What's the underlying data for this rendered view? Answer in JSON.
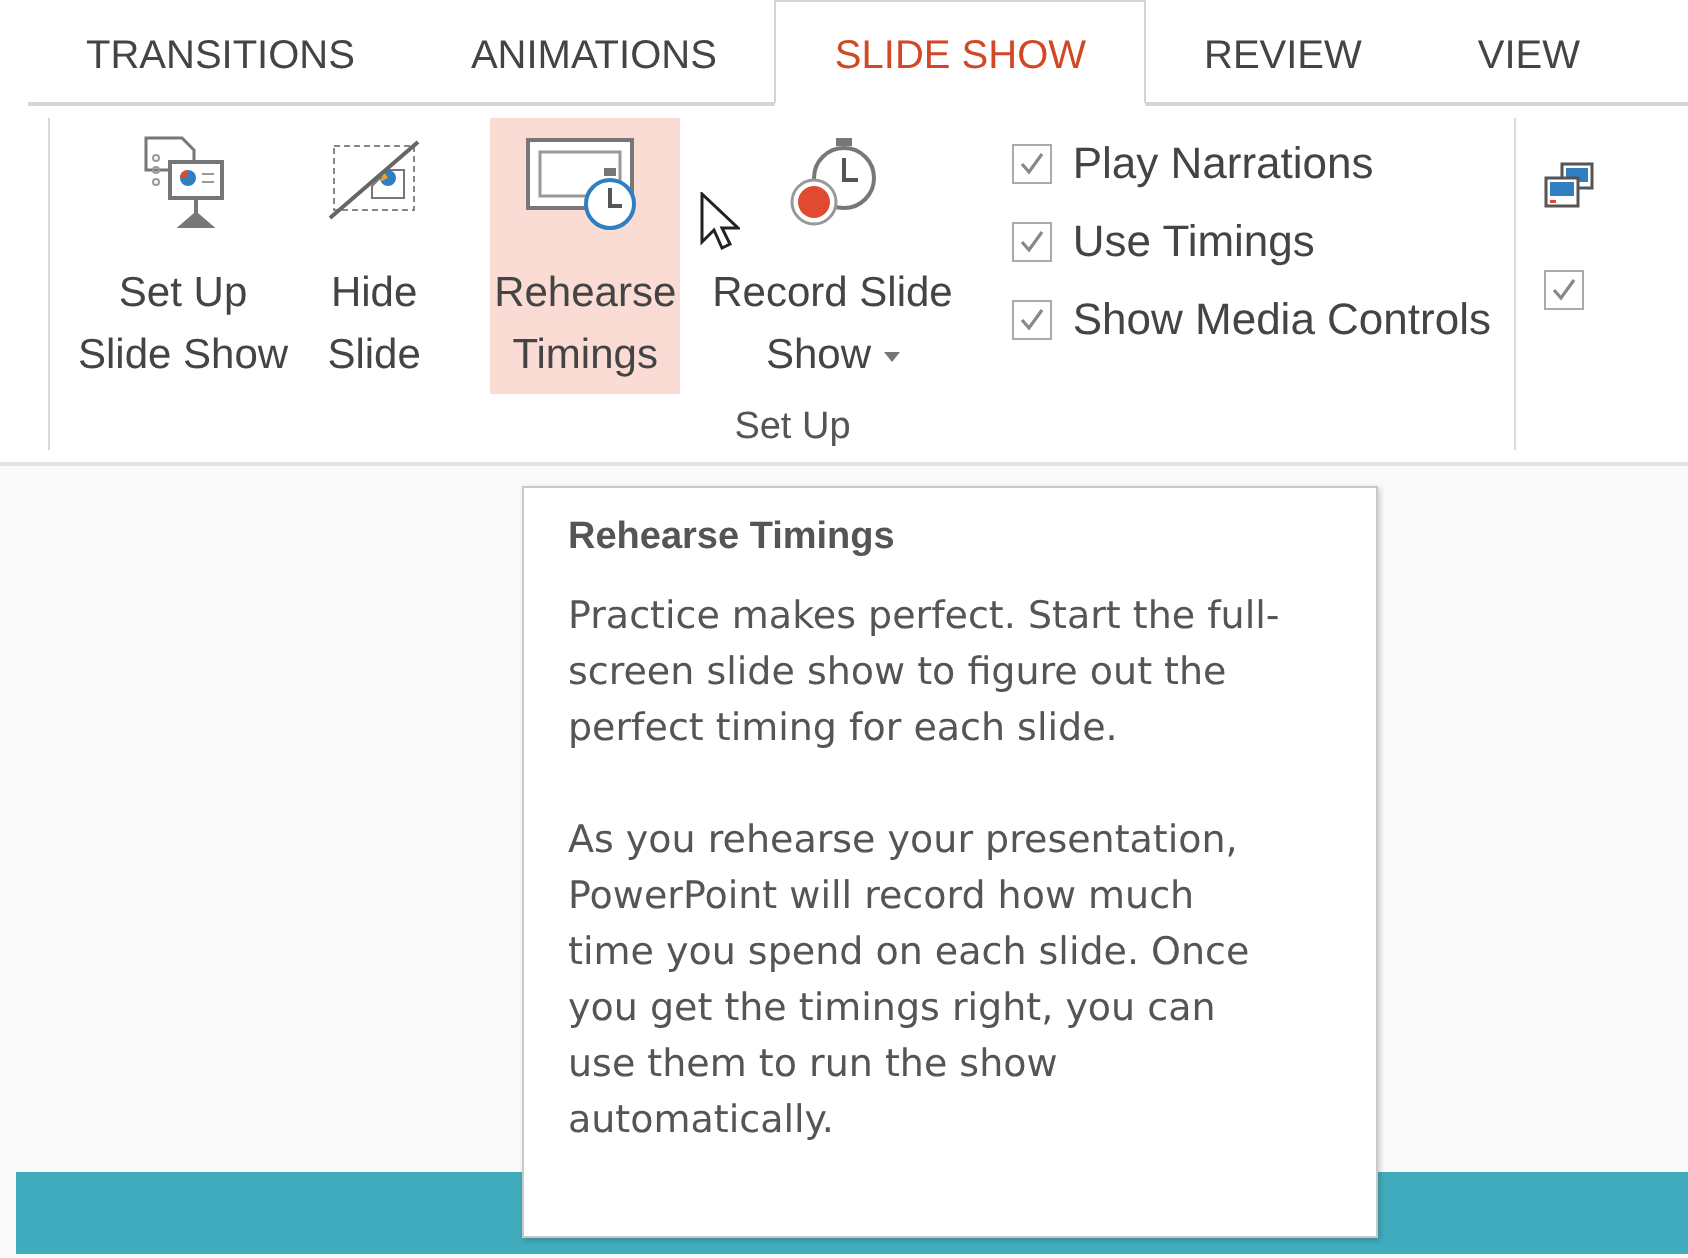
{
  "tabs": [
    {
      "label": "TRANSITIONS",
      "selected": false
    },
    {
      "label": "ANIMATIONS",
      "selected": false
    },
    {
      "label": "SLIDE SHOW",
      "selected": true
    },
    {
      "label": "REVIEW",
      "selected": false
    },
    {
      "label": "VIEW",
      "selected": false
    }
  ],
  "ribbon": {
    "buttons": [
      {
        "kind": "setup",
        "label_lines": [
          "Set Up",
          "Slide Show"
        ],
        "hovered": false,
        "dropdown": false
      },
      {
        "kind": "hide",
        "label_lines": [
          "Hide",
          "Slide"
        ],
        "hovered": false,
        "dropdown": false
      },
      {
        "kind": "rehearse",
        "label_lines": [
          "Rehearse",
          "Timings"
        ],
        "hovered": true,
        "dropdown": false
      },
      {
        "kind": "record",
        "label_lines": [
          "Record Slide",
          "Show"
        ],
        "hovered": false,
        "dropdown": true
      }
    ],
    "checkboxes": [
      {
        "label": "Play Narrations",
        "checked": true
      },
      {
        "label": "Use Timings",
        "checked": true
      },
      {
        "label": "Show Media Controls",
        "checked": true
      }
    ],
    "group_label": "Set Up",
    "next_group": {
      "checkbox": {
        "checked": true
      }
    }
  },
  "tooltip": {
    "title": "Rehearse Timings",
    "paragraphs": [
      "Practice makes perfect. Start the full-screen slide show to figure out the perfect timing for each slide.",
      "As you rehearse your presentation, PowerPoint will record how much time you spend on each slide. Once you get the timings right, you can use them to run the show automatically."
    ]
  }
}
